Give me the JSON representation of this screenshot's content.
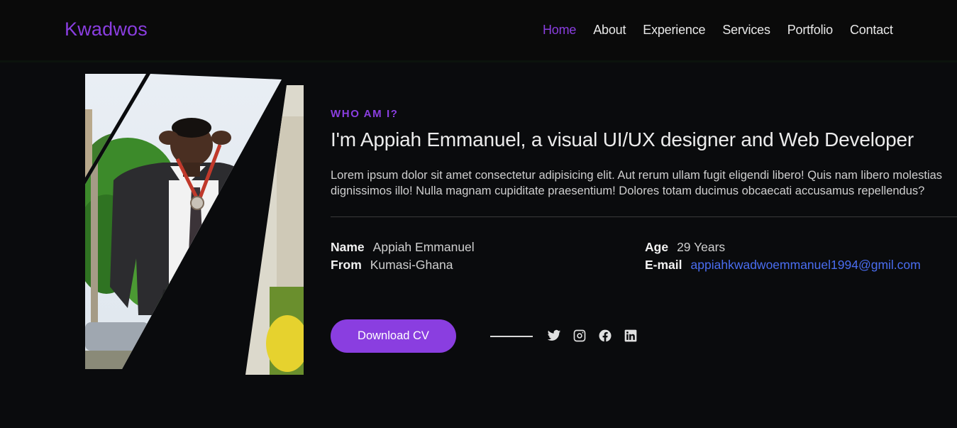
{
  "brand": "Kwadwos",
  "nav": [
    {
      "label": "Home",
      "active": true
    },
    {
      "label": "About"
    },
    {
      "label": "Experience"
    },
    {
      "label": "Services"
    },
    {
      "label": "Portfolio"
    },
    {
      "label": "Contact"
    }
  ],
  "hero": {
    "eyebrow": "WHO AM I?",
    "headline": "I'm Appiah Emmanuel, a visual UI/UX designer and Web Developer",
    "lede": "Lorem ipsum dolor sit amet consectetur adipisicing elit. Aut rerum ullam fugit eligendi libero! Quis nam libero molestias dignissimos illo! Nulla magnam cupiditate praesentium! Dolores totam ducimus obcaecati accusamus repellendus?",
    "photo_icon": "portrait-photo"
  },
  "info": {
    "name_label": "Name",
    "name_value": "Appiah Emmanuel",
    "from_label": "From",
    "from_value": "Kumasi-Ghana",
    "age_label": "Age",
    "age_value": "29 Years",
    "email_label": "E-mail",
    "email_value": "appiahkwadwoemmanuel1994@gmil.com"
  },
  "actions": {
    "download_label": "Download CV",
    "social": [
      "twitter-icon",
      "instagram-icon",
      "facebook-icon",
      "linkedin-icon"
    ]
  },
  "colors": {
    "accent": "#8a3ee0",
    "background": "#0a0b0d",
    "link": "#4a6df0"
  }
}
